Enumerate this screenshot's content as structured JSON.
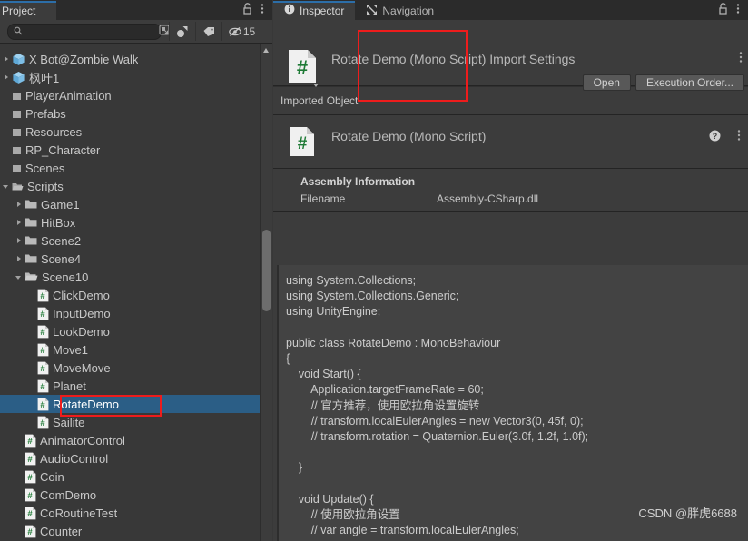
{
  "project_panel": {
    "tab_label": "Project",
    "tab_icons": {
      "lock": "lock-icon",
      "menu": "kebab-menu-icon"
    },
    "search": {
      "value": "",
      "placeholder": ""
    },
    "toolbar": {
      "search_icon": "search-icon",
      "save_search_icon": "save-search-icon",
      "type_filter_icon": "object-type-filter-icon",
      "label_filter_icon": "label-filter-icon",
      "hidden_icon": "hidden-eye-icon",
      "hidden_count": "15"
    },
    "tree": [
      {
        "label": "X Bot@Zombie Walk",
        "icon": "prefab-icon",
        "indent": 0,
        "twisty": "closed",
        "selected": false
      },
      {
        "label": "枫叶1",
        "icon": "prefab-icon",
        "indent": 0,
        "twisty": "closed",
        "selected": false
      },
      {
        "label": "PlayerAnimation",
        "icon": "folder-small-icon",
        "indent": 0,
        "twisty": "none",
        "selected": false
      },
      {
        "label": "Prefabs",
        "icon": "folder-small-icon",
        "indent": 0,
        "twisty": "none",
        "selected": false
      },
      {
        "label": "Resources",
        "icon": "folder-small-icon",
        "indent": 0,
        "twisty": "none",
        "selected": false
      },
      {
        "label": "RP_Character",
        "icon": "folder-small-icon",
        "indent": 0,
        "twisty": "none",
        "selected": false
      },
      {
        "label": "Scenes",
        "icon": "folder-small-icon",
        "indent": 0,
        "twisty": "none",
        "selected": false
      },
      {
        "label": "Scripts",
        "icon": "folder-open-small-icon",
        "indent": 0,
        "twisty": "open",
        "selected": false
      },
      {
        "label": "Game1",
        "icon": "folder-icon",
        "indent": 1,
        "twisty": "closed",
        "selected": false
      },
      {
        "label": "HitBox",
        "icon": "folder-icon",
        "indent": 1,
        "twisty": "closed",
        "selected": false
      },
      {
        "label": "Scene2",
        "icon": "folder-icon",
        "indent": 1,
        "twisty": "closed",
        "selected": false
      },
      {
        "label": "Scene4",
        "icon": "folder-icon",
        "indent": 1,
        "twisty": "closed",
        "selected": false
      },
      {
        "label": "Scene10",
        "icon": "folder-open-icon",
        "indent": 1,
        "twisty": "open",
        "selected": false
      },
      {
        "label": "ClickDemo",
        "icon": "cs-script-icon",
        "indent": 2,
        "twisty": "none",
        "selected": false
      },
      {
        "label": "InputDemo",
        "icon": "cs-script-icon",
        "indent": 2,
        "twisty": "none",
        "selected": false
      },
      {
        "label": "LookDemo",
        "icon": "cs-script-icon",
        "indent": 2,
        "twisty": "none",
        "selected": false
      },
      {
        "label": "Move1",
        "icon": "cs-script-icon",
        "indent": 2,
        "twisty": "none",
        "selected": false
      },
      {
        "label": "MoveMove",
        "icon": "cs-script-icon",
        "indent": 2,
        "twisty": "none",
        "selected": false
      },
      {
        "label": "Planet",
        "icon": "cs-script-icon",
        "indent": 2,
        "twisty": "none",
        "selected": false
      },
      {
        "label": "RotateDemo",
        "icon": "cs-script-icon",
        "indent": 2,
        "twisty": "none",
        "selected": true
      },
      {
        "label": "Sailite",
        "icon": "cs-script-icon",
        "indent": 2,
        "twisty": "none",
        "selected": false
      },
      {
        "label": "AnimatorControl",
        "icon": "cs-script-icon",
        "indent": 1,
        "twisty": "none",
        "selected": false
      },
      {
        "label": "AudioControl",
        "icon": "cs-script-icon",
        "indent": 1,
        "twisty": "none",
        "selected": false
      },
      {
        "label": "Coin",
        "icon": "cs-script-icon",
        "indent": 1,
        "twisty": "none",
        "selected": false
      },
      {
        "label": "ComDemo",
        "icon": "cs-script-icon",
        "indent": 1,
        "twisty": "none",
        "selected": false
      },
      {
        "label": "CoRoutineTest",
        "icon": "cs-script-icon",
        "indent": 1,
        "twisty": "none",
        "selected": false
      },
      {
        "label": "Counter",
        "icon": "cs-script-icon",
        "indent": 1,
        "twisty": "none",
        "selected": false
      }
    ]
  },
  "inspector_panel": {
    "tabs": [
      {
        "label": "Inspector",
        "icon": "info-icon",
        "active": true
      },
      {
        "label": "Navigation",
        "icon": "navigation-icon",
        "active": false
      }
    ],
    "tab_icons": {
      "lock": "lock-icon",
      "menu": "kebab-menu-icon"
    },
    "header": {
      "title": "Rotate Demo (Mono Script) Import Settings",
      "icon": "cs-script-large-icon",
      "open_button": "Open",
      "execution_order_button": "Execution Order..."
    },
    "imported_object": {
      "section_label": "Imported Object",
      "title": "Rotate Demo (Mono Script)",
      "icon": "cs-script-large-icon",
      "help_icon": "help-icon",
      "menu_icon": "kebab-menu-icon"
    },
    "assembly_information": {
      "title": "Assembly Information",
      "filename_label": "Filename",
      "filename_value": "Assembly-CSharp.dll"
    },
    "code": "using System.Collections;\nusing System.Collections.Generic;\nusing UnityEngine;\n\npublic class RotateDemo : MonoBehaviour\n{\n    void Start() {\n        Application.targetFrameRate = 60;\n        // 官方推荐，使用欧拉角设置旋转\n        // transform.localEulerAngles = new Vector3(0, 45f, 0);\n        // transform.rotation = Quaternion.Euler(3.0f, 1.2f, 1.0f);\n\n    }\n\n    void Update() {\n        // 使用欧拉角设置\n        // var angle = transform.localEulerAngles;"
  },
  "watermark": "CSDN @胖虎6688",
  "annotations": {
    "execution_order_highlight": "red-rectangle",
    "rotate_demo_highlight": "red-rectangle"
  },
  "colors": {
    "panel_bg": "#3c3c3c",
    "tree_bg": "#383838",
    "tab_bar_bg": "#2b2b2b",
    "selection_blue": "#2b5e86",
    "accent_blue": "#2c6ea8",
    "annotation_red": "#ee1c1c",
    "code_bg": "#434343"
  }
}
